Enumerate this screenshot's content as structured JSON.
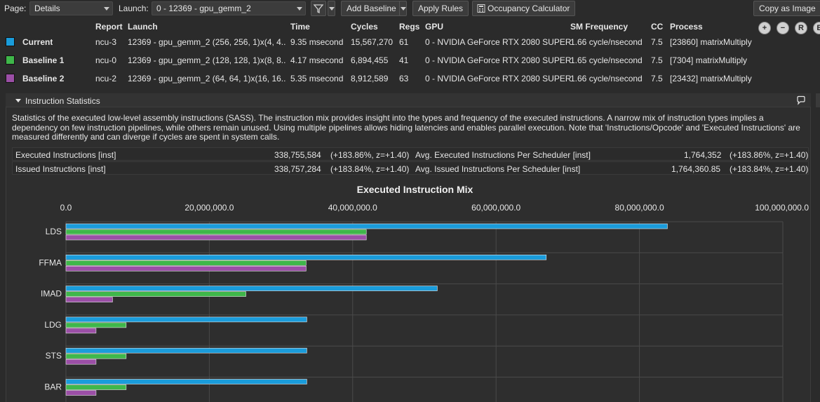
{
  "toolbar": {
    "page_label": "Page:",
    "page_value": "Details",
    "launch_label": "Launch:",
    "launch_value": "0 - 12369 - gpu_gemm_2",
    "add_baseline_label": "Add Baseline",
    "apply_rules_label": "Apply Rules",
    "occupancy_label": "Occupancy Calculator",
    "copy_image_label": "Copy as Image"
  },
  "results": {
    "headers": [
      "Report",
      "Launch",
      "Time",
      "Cycles",
      "Regs",
      "GPU",
      "SM Frequency",
      "CC",
      "Process"
    ],
    "rows": [
      {
        "name": "Current",
        "color": "#1a9cdb",
        "report": "ncu-3",
        "launch": "12369 - gpu_gemm_2 (256, 256, 1)x(4, 4...",
        "time": "9.35 msecond",
        "cycles": "15,567,270",
        "regs": "61",
        "gpu": "0 - NVIDIA GeForce RTX 2080 SUPER",
        "sm_freq": "1.66 cycle/nsecond",
        "cc": "7.5",
        "process": "[23860] matrixMultiply"
      },
      {
        "name": "Baseline 1",
        "color": "#3fb74a",
        "report": "ncu-0",
        "launch": "12369 - gpu_gemm_2 (128, 128, 1)x(8, 8...",
        "time": "4.17 msecond",
        "cycles": "6,894,455",
        "regs": "41",
        "gpu": "0 - NVIDIA GeForce RTX 2080 SUPER",
        "sm_freq": "1.65 cycle/nsecond",
        "cc": "7.5",
        "process": "[7304] matrixMultiply"
      },
      {
        "name": "Baseline 2",
        "color": "#9b4fa6",
        "report": "ncu-2",
        "launch": "12369 - gpu_gemm_2 (64, 64, 1)x(16, 16...",
        "time": "5.35 msecond",
        "cycles": "8,912,589",
        "regs": "63",
        "gpu": "0 - NVIDIA GeForce RTX 2080 SUPER",
        "sm_freq": "1.66 cycle/nsecond",
        "cc": "7.5",
        "process": "[23432] matrixMultiply"
      }
    ]
  },
  "section": {
    "title": "Instruction Statistics",
    "description": "Statistics of the executed low-level assembly instructions (SASS). The instruction mix provides insight into the types and frequency of the executed instructions. A narrow mix of instruction types implies a dependency on few instruction pipelines, while others remain unused. Using multiple pipelines allows hiding latencies and enables parallel execution. Note that 'Instructions/Opcode' and 'Executed Instructions' are measured differently and can diverge if cycles are spent in system calls.",
    "stats": [
      {
        "label": "Executed Instructions [inst]",
        "value": "338,755,584",
        "delta": "(+183.86%, z=+1.40)",
        "label2": "Avg. Executed Instructions Per Scheduler [inst]",
        "value2": "1,764,352",
        "delta2": "(+183.86%, z=+1.40)"
      },
      {
        "label": "Issued Instructions [inst]",
        "value": "338,757,284",
        "delta": "(+183.84%, z=+1.40)",
        "label2": "Avg. Issued Instructions Per Scheduler [inst]",
        "value2": "1,764,360.85",
        "delta2": "(+183.84%, z=+1.40)"
      }
    ]
  },
  "chart_data": {
    "type": "bar",
    "title": "Executed Instruction Mix",
    "xlim": [
      0,
      100000000
    ],
    "tick_labels": [
      "0.0",
      "20,000,000.0",
      "40,000,000.0",
      "60,000,000.0",
      "80,000,000.0",
      "100,000,000.0"
    ],
    "ticks": [
      0,
      20000000,
      40000000,
      60000000,
      80000000,
      100000000
    ],
    "categories": [
      "LDS",
      "FFMA",
      "IMAD",
      "LDG",
      "STS",
      "BAR"
    ],
    "series": [
      {
        "name": "Current",
        "color": "#1a9cdb",
        "values": [
          83900000,
          67000000,
          51800000,
          33600000,
          33600000,
          33600000
        ]
      },
      {
        "name": "Baseline 1",
        "color": "#3fb74a",
        "values": [
          41900000,
          33500000,
          25100000,
          8400000,
          8400000,
          8400000
        ]
      },
      {
        "name": "Baseline 2",
        "color": "#9b4fa6",
        "values": [
          41900000,
          33500000,
          6500000,
          4200000,
          4200000,
          4200000
        ]
      }
    ],
    "grid": true
  }
}
